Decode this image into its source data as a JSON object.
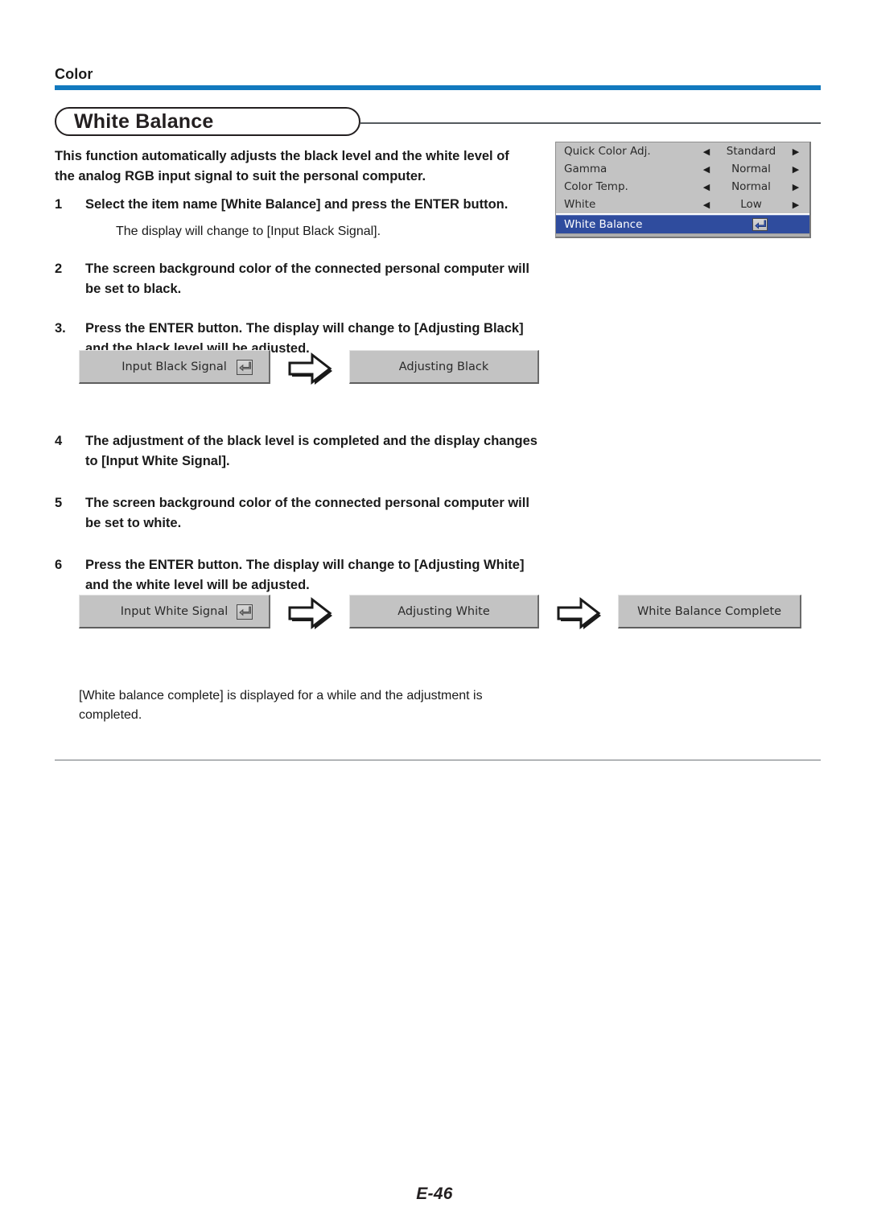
{
  "document": {
    "section_label": "Color",
    "title": "White Balance",
    "page_number": "E-46"
  },
  "intro": "This function automatically adjusts the black level and the white level of the analog RGB input signal to suit the personal computer.",
  "steps_group_1": [
    {
      "number": "1",
      "text": "Select the item name [White Balance] and press the ENTER button.",
      "note": "The display will change to [Input Black Signal]."
    },
    {
      "number": "2",
      "text": "The screen background color of the connected personal computer will be set to black.",
      "note": ""
    },
    {
      "number": "3.",
      "text": "Press the ENTER button. The display will change to [Adjusting Black] and the black level will be adjusted.",
      "note": ""
    }
  ],
  "steps_group_2": [
    {
      "number": "4",
      "text": "The adjustment of the black level is completed and the display changes to [Input White Signal].",
      "note": ""
    },
    {
      "number": "5",
      "text": "The screen background color of the connected personal computer will be set to white.",
      "note": ""
    },
    {
      "number": "6",
      "text": "Press the ENTER button. The display will change to [Adjusting White] and the white level will be adjusted.",
      "note": ""
    }
  ],
  "closing": "[White balance complete] is displayed for a while and the adjustment is completed.",
  "osd_menu": {
    "rows": [
      {
        "label": "Quick Color Adj.",
        "left_arrow": "◀",
        "value": "Standard",
        "right_arrow": "▶"
      },
      {
        "label": "Gamma",
        "left_arrow": "◀",
        "value": "Normal",
        "right_arrow": "▶"
      },
      {
        "label": "Color Temp.",
        "left_arrow": "◀",
        "value": "Normal",
        "right_arrow": "▶"
      },
      {
        "label": "White",
        "left_arrow": "◀",
        "value": "Low",
        "right_arrow": "▶"
      }
    ],
    "selected_row": {
      "label": "White Balance",
      "icon": "enter-key-icon"
    },
    "colors": {
      "background": "#c3c3c3",
      "selection": "#2f4c9e",
      "selection_text": "#ffffff"
    }
  },
  "flow_black": {
    "step_1_label": "Input Black Signal",
    "step_1_icon": "enter-key-icon",
    "arrow_1": "right-arrow-icon",
    "step_2_label": "Adjusting Black"
  },
  "flow_white": {
    "step_1_label": "Input White Signal",
    "step_1_icon": "enter-key-icon",
    "arrow_1": "right-arrow-icon",
    "step_2_label": "Adjusting White",
    "arrow_2": "right-arrow-icon",
    "step_3_label": "White Balance Complete"
  },
  "colors": {
    "accent_bar": "#1279BE",
    "rule": "#6e7478",
    "text": "#1a1a1a"
  }
}
